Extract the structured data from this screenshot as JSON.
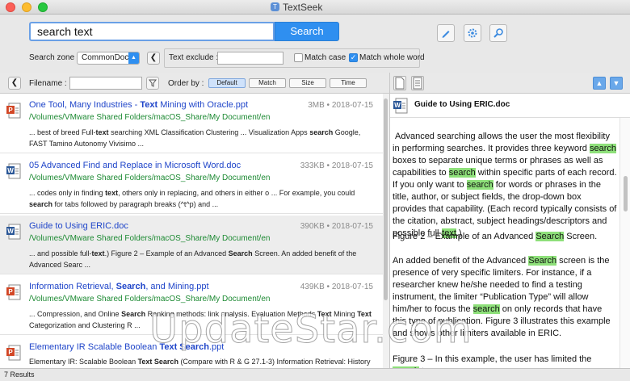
{
  "window": {
    "title": "TextSeek"
  },
  "search": {
    "value": "search text",
    "button_label": "Search"
  },
  "zone": {
    "label": "Search zone :",
    "selected": "CommonDoc"
  },
  "exclude": {
    "label": "Text exclude :",
    "value": ""
  },
  "options": {
    "match_case": {
      "label": "Match case",
      "checked": false
    },
    "match_whole_word": {
      "label": "Match whole word",
      "checked": true
    }
  },
  "toolbar_icons": [
    "edit-icon",
    "settings-icon",
    "search-tool-icon"
  ],
  "filter": {
    "filename_label": "Filename :",
    "filename_value": "",
    "order_label": "Order by :",
    "order_options": [
      "Default",
      "Match",
      "Size",
      "Time"
    ],
    "order_selected": "Default"
  },
  "results": [
    {
      "icon": "ppt",
      "title_parts": [
        {
          "t": "One Tool, Many Industries - ",
          "b": false
        },
        {
          "t": "Text",
          "b": true
        },
        {
          "t": " Mining with Oracle.ppt",
          "b": false
        }
      ],
      "size": "3MB",
      "date": "2018-07-15",
      "path": "/Volumes/VMware Shared Folders/macOS_Share/My Document/en",
      "snippet_parts": [
        {
          "t": "... best of breed Full-",
          "b": false
        },
        {
          "t": "text",
          "b": true
        },
        {
          "t": " searching XML Classification Clustering ... Visualization Apps ",
          "b": false
        },
        {
          "t": "search",
          "b": true
        },
        {
          "t": " Google, FAST Tamino Autonomy Vivisimo ...",
          "b": false
        }
      ]
    },
    {
      "icon": "doc",
      "title_parts": [
        {
          "t": "05 Advanced Find and Replace in Microsoft Word.doc",
          "b": false
        }
      ],
      "size": "333KB",
      "date": "2018-07-15",
      "path": "/Volumes/VMware Shared Folders/macOS_Share/My Document/en",
      "snippet_parts": [
        {
          "t": "... codes only in finding ",
          "b": false
        },
        {
          "t": "text",
          "b": true
        },
        {
          "t": ", others only in replacing, and others in either o ... For example, you could ",
          "b": false
        },
        {
          "t": "search",
          "b": true
        },
        {
          "t": " for tabs followed by paragraph breaks (^t^p) and ...",
          "b": false
        }
      ]
    },
    {
      "icon": "doc",
      "title_parts": [
        {
          "t": "Guide to Using ERIC.doc",
          "b": false
        }
      ],
      "size": "390KB",
      "date": "2018-07-15",
      "path": "/Volumes/VMware Shared Folders/macOS_Share/My Document/en",
      "snippet_parts": [
        {
          "t": "... and possible full-",
          "b": false
        },
        {
          "t": "text",
          "b": true
        },
        {
          "t": ".) Figure 2 – Example of an Advanced ",
          "b": false
        },
        {
          "t": "Search",
          "b": true
        },
        {
          "t": " Screen. An added benefit of the Advanced Searc ...",
          "b": false
        }
      ]
    },
    {
      "icon": "ppt",
      "title_parts": [
        {
          "t": "Information Retrieval, ",
          "b": false
        },
        {
          "t": "Search",
          "b": true
        },
        {
          "t": ", and Mining.ppt",
          "b": false
        }
      ],
      "size": "439KB",
      "date": "2018-07-15",
      "path": "/Volumes/VMware Shared Folders/macOS_Share/My Document/en",
      "snippet_parts": [
        {
          "t": "... Compression, and Online ",
          "b": false
        },
        {
          "t": "Search",
          "b": true
        },
        {
          "t": " Ranking methods: link analysis. Evaluation Methods ",
          "b": false
        },
        {
          "t": "Text",
          "b": true
        },
        {
          "t": " Mining ",
          "b": false
        },
        {
          "t": "Text",
          "b": true
        },
        {
          "t": " Categorization and Clustering R ...",
          "b": false
        }
      ]
    },
    {
      "icon": "ppt",
      "title_parts": [
        {
          "t": "Elementary IR Scalable Boolean ",
          "b": false
        },
        {
          "t": "Text Search",
          "b": true
        },
        {
          "t": ".ppt",
          "b": false
        }
      ],
      "size": "",
      "date": "",
      "path": "",
      "snippet_parts": [
        {
          "t": "Elementary IR: Scalable Boolean ",
          "b": false
        },
        {
          "t": "Text Search",
          "b": true
        },
        {
          "t": " (Compare with R & G 27.1-3) Information Retrieval: History A",
          "b": false
        }
      ]
    }
  ],
  "preview": {
    "title": "Guide to Using ERIC.doc",
    "paragraphs": [
      [
        {
          "t": "Advanced searching allows the user the most flexibility in performing searches. It provides three keyword ",
          "h": false
        },
        {
          "t": "search",
          "h": true
        },
        {
          "t": " boxes to separate unique terms or phrases as well as capabilities to ",
          "h": false
        },
        {
          "t": "search",
          "h": true
        },
        {
          "t": " within specific parts of each record. If you only want to ",
          "h": false
        },
        {
          "t": "search",
          "h": true
        },
        {
          "t": " for words or phrases in the title, author, or subject fields, the drop-down box provides that capability.  (Each record typically consists of the citation, abstract, subject headings/descriptors and possible full-",
          "h": false
        },
        {
          "t": "text",
          "h": true
        },
        {
          "t": ".)",
          "h": false
        }
      ],
      [
        {
          "t": "Figure 2 – Example of an Advanced ",
          "h": false
        },
        {
          "t": "Search",
          "h": true
        },
        {
          "t": " Screen.",
          "h": false
        }
      ],
      [
        {
          "t": "An added benefit of the Advanced ",
          "h": false
        },
        {
          "t": "Search",
          "h": true
        },
        {
          "t": " screen is the presence of very specific limiters. For instance, if a researcher knew he/she needed to find a testing instrument, the limiter “Publication Type” will allow him/her to focus the ",
          "h": false
        },
        {
          "t": "search",
          "h": true
        },
        {
          "t": " on only records that have this type of publication. Figure 3 illustrates this example and shows other limiters available in ERIC.",
          "h": false
        }
      ],
      [
        {
          "t": "Figure 3 – In this example, the user has limited the ",
          "h": false
        },
        {
          "t": "search",
          "h": true
        },
        {
          "t": " to ... ",
          "h": false
        }
      ]
    ]
  },
  "status": {
    "text": "7 Results"
  },
  "watermark": "UpdateStar.com",
  "colors": {
    "accent": "#2f8ff0",
    "link": "#1f45c9",
    "path": "#1d8a33",
    "highlight": "#8ee07a"
  }
}
